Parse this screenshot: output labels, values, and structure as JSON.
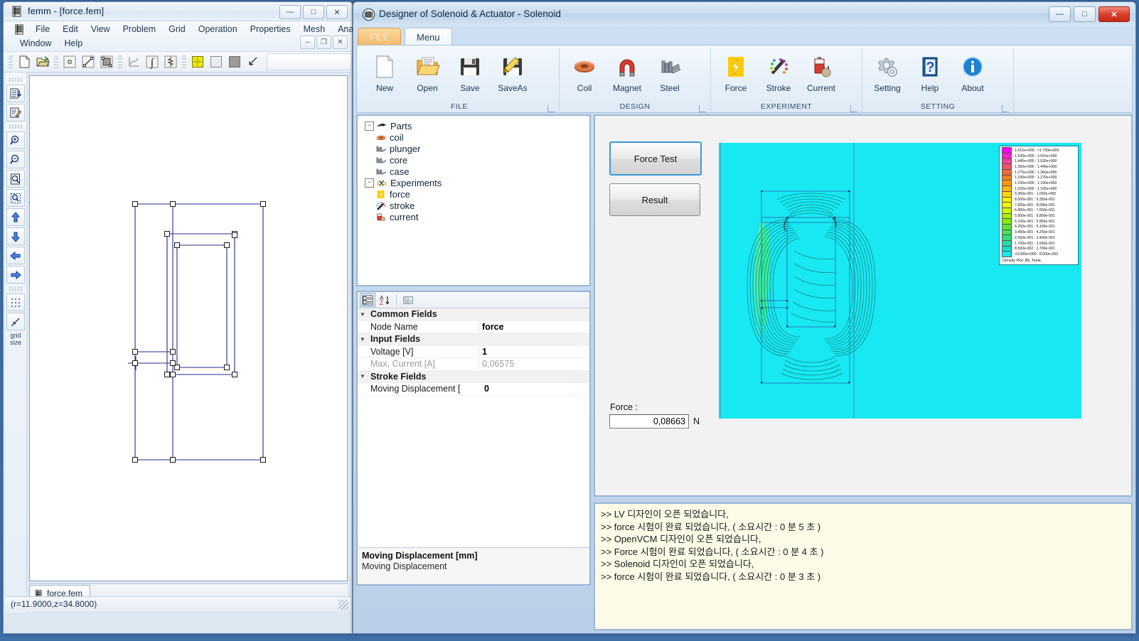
{
  "femm": {
    "title": "femm  - [force.fem]",
    "app_icon": "femm-coil-icon",
    "window_buttons": [
      {
        "name": "minimize",
        "glyph": "—"
      },
      {
        "name": "maximize",
        "glyph": "□"
      },
      {
        "name": "close",
        "glyph": "✕"
      }
    ],
    "menus_row1": [
      "File",
      "Edit",
      "View",
      "Problem",
      "Grid",
      "Operation",
      "Properties",
      "Mesh",
      "Analysis"
    ],
    "menus_row2": [
      "Window",
      "Help"
    ],
    "mdi_buttons": [
      {
        "name": "mdi-minimize",
        "glyph": "–"
      },
      {
        "name": "mdi-restore",
        "glyph": "❐"
      },
      {
        "name": "mdi-close",
        "glyph": "✕"
      }
    ],
    "toolbar_items": [
      "new-file-icon",
      "open-file-icon",
      "point-mode-icon",
      "segment-mode-icon",
      "block-mode-icon",
      "plot-xy-icon",
      "integrate-icon",
      "circuit-icon",
      "mesh-icon",
      "hatch-icon",
      "solid-fill-icon",
      "arrow-select-icon"
    ],
    "vtoolbar_items": [
      "list-down-icon",
      "edit-properties-icon",
      "zoom-in-icon",
      "zoom-out-icon",
      "zoom-page-icon",
      "zoom-window-icon",
      "pan-up-icon",
      "pan-down-icon",
      "pan-left-icon",
      "pan-right-icon",
      "grid-dots-icon",
      "snap-grid-icon"
    ],
    "vtoolbar_text": "grid size",
    "tab_label": "force,fem",
    "status_text": "(r=11.9000,z=34.8000)"
  },
  "designer": {
    "title": "Designer of Solenoid & Actuator - Solenoid",
    "app_icon": "solenoid-coil-icon",
    "window_buttons": [
      {
        "name": "minimize",
        "glyph": "—"
      },
      {
        "name": "maximize",
        "glyph": "□"
      },
      {
        "name": "close",
        "glyph": "✕"
      }
    ],
    "ribbon_tabs": [
      {
        "name": "tab-file",
        "label": "FILE"
      },
      {
        "name": "tab-menu",
        "label": "Menu"
      }
    ],
    "ribbon_groups": [
      {
        "name": "group-file",
        "label": "FILE",
        "items": [
          {
            "label": "New",
            "icon": "new-document-icon"
          },
          {
            "label": "Open",
            "icon": "open-folder-icon"
          },
          {
            "label": "Save",
            "icon": "floppy-save-icon"
          },
          {
            "label": "SaveAs",
            "icon": "floppy-saveas-pencil-icon"
          }
        ]
      },
      {
        "name": "group-design",
        "label": "DESIGN",
        "items": [
          {
            "label": "Coil",
            "icon": "copper-torus-coil-icon"
          },
          {
            "label": "Magnet",
            "icon": "horseshoe-magnet-icon"
          },
          {
            "label": "Steel",
            "icon": "steel-bars-icon"
          }
        ]
      },
      {
        "name": "group-experiment",
        "label": "EXPERIMENT",
        "items": [
          {
            "label": "Force",
            "icon": "yellow-lightning-icon"
          },
          {
            "label": "Stroke",
            "icon": "pencil-palette-icon"
          },
          {
            "label": "Current",
            "icon": "battery-plug-icon"
          }
        ]
      },
      {
        "name": "group-setting",
        "label": "SETTING",
        "items": [
          {
            "label": "Setting",
            "icon": "gear-icon"
          },
          {
            "label": "Help",
            "icon": "blue-help-book-icon"
          },
          {
            "label": "About",
            "icon": "blue-info-icon"
          }
        ]
      }
    ],
    "tree": [
      {
        "label": "Parts",
        "icon": "parts-icon",
        "level": 0,
        "expanded": true
      },
      {
        "label": "coil",
        "icon": "coil-icon",
        "level": 1
      },
      {
        "label": "plunger",
        "icon": "steel-bars-icon",
        "level": 1
      },
      {
        "label": "core",
        "icon": "steel-bars-icon",
        "level": 1
      },
      {
        "label": "case",
        "icon": "steel-bars-icon",
        "level": 1
      },
      {
        "label": "Experiments",
        "icon": "experiments-icon",
        "level": 0,
        "expanded": true
      },
      {
        "label": "force",
        "icon": "yellow-lightning-icon",
        "level": 1
      },
      {
        "label": "stroke",
        "icon": "pencil-palette-icon",
        "level": 1
      },
      {
        "label": "current",
        "icon": "battery-plug-icon",
        "level": 1
      }
    ],
    "property_grid": {
      "toolbar": [
        "categorized-icon",
        "alphabetic-sort-icon",
        "property-pages-icon"
      ],
      "rows": [
        {
          "kind": "category",
          "name": "Common Fields"
        },
        {
          "kind": "prop",
          "name": "Node Name",
          "value": "force",
          "dim": false
        },
        {
          "kind": "category",
          "name": "Input Fields"
        },
        {
          "kind": "prop",
          "name": "Voltage [V]",
          "value": "1",
          "dim": false
        },
        {
          "kind": "prop",
          "name": "Max, Current [A]",
          "value": "0,06575",
          "dim": true
        },
        {
          "kind": "category",
          "name": "Stroke Fields"
        },
        {
          "kind": "prop",
          "name": "Moving Displacement [",
          "value": "0",
          "dim": false
        }
      ],
      "description_title": "Moving Displacement [mm]",
      "description_text": "Moving Displacement"
    },
    "work_area": {
      "force_test_button": "Force Test",
      "result_button": "Result",
      "force_label": "Force :",
      "force_value": "0,08663",
      "force_unit": "N"
    },
    "legend": {
      "caption": "Density Plot: |B|, Tesla",
      "entries": [
        {
          "color": "#ff00ff",
          "text": "1.615e+000 : >1.700e+000"
        },
        {
          "color": "#ff22cc",
          "text": "1.530e+000 : 1.615e+000"
        },
        {
          "color": "#fa3f9c",
          "text": "1.445e+000 : 1.530e+000"
        },
        {
          "color": "#f1526d",
          "text": "1.360e+000 : 1.445e+000"
        },
        {
          "color": "#ec6a3a",
          "text": "1.275e+000 : 1.360e+000"
        },
        {
          "color": "#f4821c",
          "text": "1.190e+000 : 1.275e+000"
        },
        {
          "color": "#f99a11",
          "text": "1.105e+000 : 1.190e+000"
        },
        {
          "color": "#fdb40a",
          "text": "1.020e+000 : 1.105e+000"
        },
        {
          "color": "#ffd400",
          "text": "9.350e-001 : 1.020e+000"
        },
        {
          "color": "#fff000",
          "text": "8.500e-001 : 9.350e-001"
        },
        {
          "color": "#eaf900",
          "text": "7.650e-001 : 8.500e-001"
        },
        {
          "color": "#ccf600",
          "text": "6.800e-001 : 7.650e-001"
        },
        {
          "color": "#a9f000",
          "text": "5.950e-001 : 6.800e-001"
        },
        {
          "color": "#80ea11",
          "text": "5.100e-001 : 5.950e-001"
        },
        {
          "color": "#5ce436",
          "text": "4.250e-001 : 5.100e-001"
        },
        {
          "color": "#44e058",
          "text": "3.400e-001 : 4.250e-001"
        },
        {
          "color": "#34dd7d",
          "text": "2.550e-001 : 3.400e-001"
        },
        {
          "color": "#24dca6",
          "text": "1.700e-001 : 2.550e-001"
        },
        {
          "color": "#18dfcc",
          "text": "8.500e-002 : 1.700e-001"
        },
        {
          "color": "#12e8ef",
          "text": "<0.000e+000 : 8.500e-002"
        }
      ]
    },
    "log_lines": [
      ">> LV 디자인이 오픈 되었습니다,",
      ">> force 시험이 완료 되었습니다, ( 소요시간 : 0 분 5 초 )",
      ">> OpenVCM 디자인이 오픈 되었습니다,",
      ">> Force 시험이 완료 되었습니다, ( 소요시간 : 0 분 4 초 )",
      ">> Solenoid 디자인이 오픈 되었습니다,",
      ">> force 시험이 완료 되었습니다, ( 소요시간 : 0 분 3 초 )"
    ]
  },
  "colors": {
    "accent_blue": "#3c9ad4",
    "plot_cyan": "#17e8f2",
    "geometry_navy": "#252a8c",
    "log_background": "#fbfbe8",
    "ribbon_yellow": "#ffcc00",
    "close_red": "#d93b26"
  }
}
